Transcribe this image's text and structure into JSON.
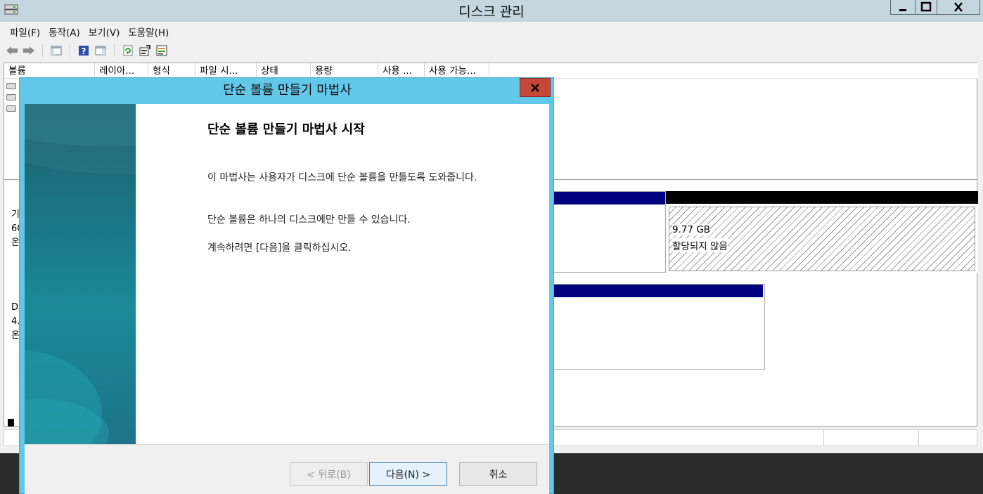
{
  "window": {
    "title": "디스크 관리"
  },
  "menu": [
    "파일(F)",
    "동작(A)",
    "보기(V)",
    "도움말(H)"
  ],
  "toolbar": {
    "icons": [
      "back-icon",
      "forward-icon",
      "console-tree-icon",
      "help-icon",
      "show-pane-icon",
      "refresh-icon",
      "properties-icon",
      "settings-icon"
    ]
  },
  "volume_list": {
    "columns": [
      "볼륨",
      "레이아...",
      "형식",
      "파일 시...",
      "상태",
      "용량",
      "사용 ...",
      "사용 가능..."
    ]
  },
  "disks": [
    {
      "label_lines": [
        "기",
        "60",
        "온"
      ]
    },
    {
      "label_lines": [
        "D",
        "4.",
        "온"
      ]
    }
  ],
  "unallocated": {
    "size": "9.77 GB",
    "status": "할당되지 않음"
  },
  "wizard": {
    "title": "단순 볼륨 만들기 마법사",
    "heading": "단순 볼륨 만들기 마법사 시작",
    "para1": "이 마법사는 사용자가 디스크에 단순 볼륨을 만들도록 도와줍니다.",
    "para2": "단순 볼륨은 하나의 디스크에만 만들 수 있습니다.",
    "para3": "계속하려면 [다음]을 클릭하십시오.",
    "back_label": "< 뒤로(B)",
    "next_label": "다음(N) >",
    "cancel_label": "취소"
  },
  "colors": {
    "wizard_frame": "#62c7e9",
    "close_red": "#c7483b",
    "partition_blue": "#000080"
  }
}
